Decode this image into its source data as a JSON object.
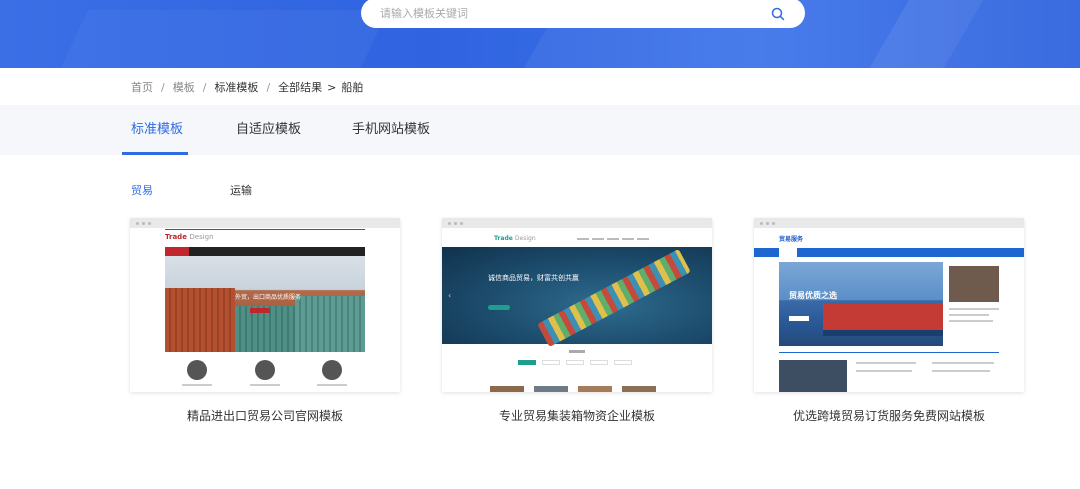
{
  "search": {
    "placeholder": "请输入模板关键词"
  },
  "breadcrumb": {
    "items": [
      "首页",
      "模板",
      "标准模板",
      "全部结果",
      "船舶"
    ],
    "separators": [
      "/",
      "/",
      "/",
      ">"
    ]
  },
  "tabs": [
    {
      "label": "标准模板",
      "active": true
    },
    {
      "label": "自适应模板",
      "active": false
    },
    {
      "label": "手机网站模板",
      "active": false
    }
  ],
  "categories": [
    {
      "label": "贸易",
      "active": true
    },
    {
      "label": "运输",
      "active": false
    }
  ],
  "cards": [
    {
      "title": "精品进出口贸易公司官网模板",
      "thumb_logo": "Trade",
      "thumb_logo_suffix": "Design",
      "thumb_hero_text": "外贸，出口商品优质服务"
    },
    {
      "title": "专业贸易集装箱物资企业模板",
      "thumb_logo": "Trade",
      "thumb_logo_suffix": "Design",
      "thumb_hero_text": "诚信商品贸易，财富共创共赢"
    },
    {
      "title": "优选跨境贸易订货服务免费网站模板",
      "thumb_logo": "贸易服务",
      "thumb_hero_text": "贸易优质之选"
    }
  ],
  "colors": {
    "accent": "#2f6be3",
    "banner": "#3a6fe6",
    "tabbar_bg": "#f5f7fa"
  }
}
